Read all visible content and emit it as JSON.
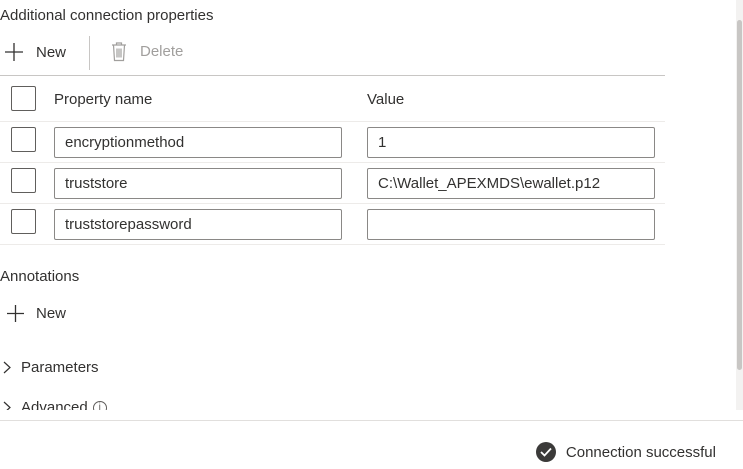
{
  "connection_properties": {
    "title": "Additional connection properties",
    "new_label": "New",
    "delete_label": "Delete",
    "columns": {
      "property_name": "Property name",
      "value": "Value"
    },
    "rows": [
      {
        "name": "encryptionmethod",
        "value": "1"
      },
      {
        "name": "truststore",
        "value": "C:\\Wallet_APEXMDS\\ewallet.p12"
      },
      {
        "name": "truststorepassword",
        "value": ""
      }
    ]
  },
  "annotations": {
    "title": "Annotations",
    "new_label": "New"
  },
  "parameters": {
    "label": "Parameters"
  },
  "advanced": {
    "label": "Advanced"
  },
  "footer": {
    "status_text": "Connection successful",
    "status_color": "#3b3a39"
  },
  "icons": [
    "plus-icon",
    "trash-icon",
    "chevron-right-icon",
    "info-icon",
    "check-circle-icon"
  ]
}
